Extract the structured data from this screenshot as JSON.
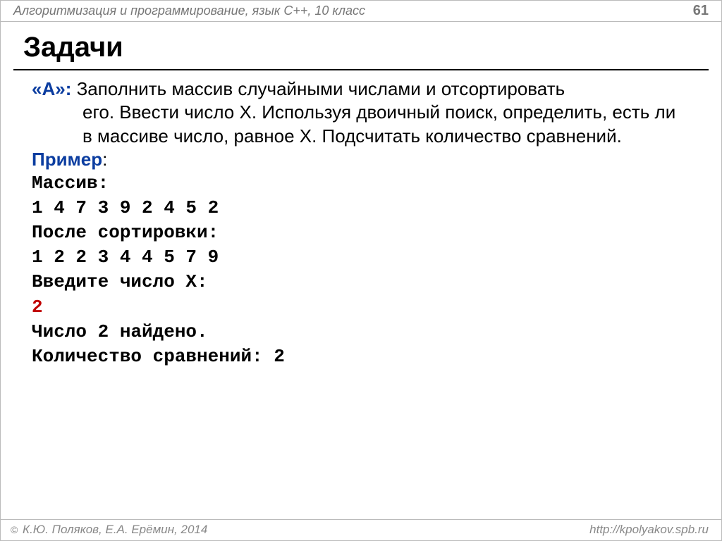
{
  "header": {
    "course": "Алгоритмизация и программирование, язык C++, 10 класс",
    "page_number": "61"
  },
  "title": "Задачи",
  "task": {
    "label": "«A»:",
    "text_line1": "Заполнить массив случайными числами и отсортировать",
    "text_rest": "его.  Ввести число X. Используя двоичный поиск, определить, есть ли в массиве число, равное X. Подсчитать количество сравнений."
  },
  "example": {
    "label": "Пример",
    "colon": ":",
    "lines": {
      "l1": "Массив:",
      "l2": "1 4 7 3 9 2 4 5 2",
      "l3": "После сортировки:",
      "l4": "1 2 2 3 4 4 5 7 9",
      "l5": "Введите число X:",
      "l6": "2",
      "l7": "Число 2 найдено.",
      "l8": "Количество сравнений: 2"
    }
  },
  "footer": {
    "copyright": " К.Ю. Поляков, Е.А. Ерёмин, 2014",
    "url": "http://kpolyakov.spb.ru"
  }
}
